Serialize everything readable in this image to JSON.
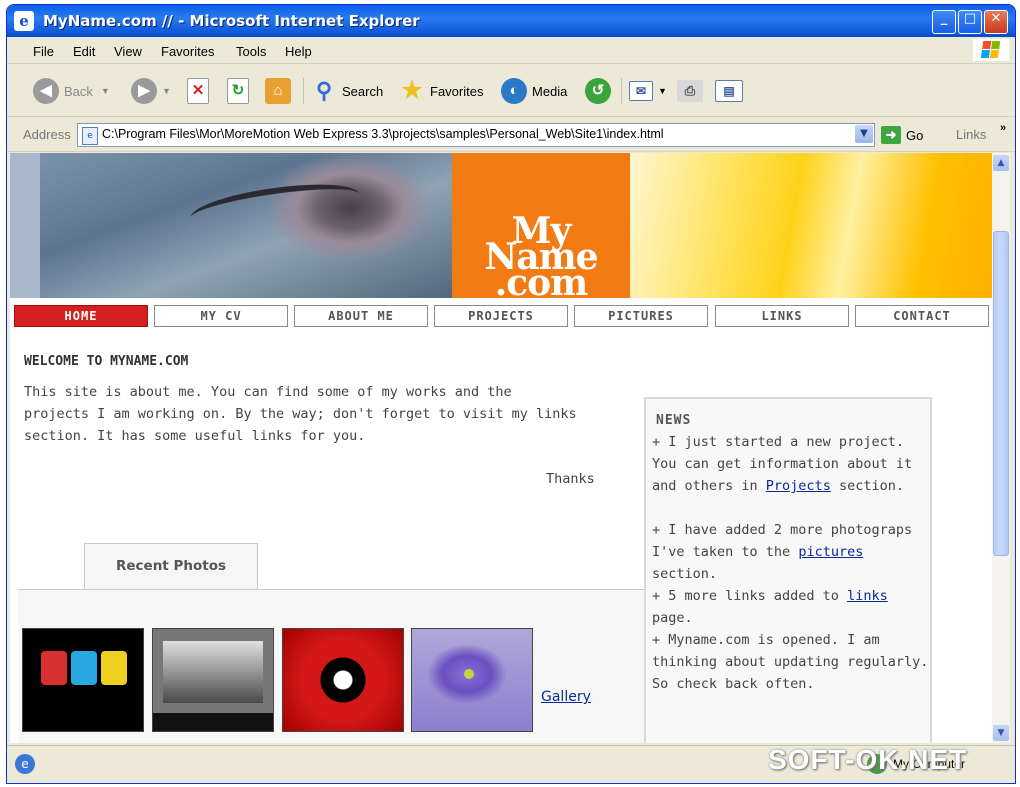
{
  "window": {
    "title": "MyName.com // - Microsoft Internet Explorer",
    "title_icon": "e",
    "minimize": "_",
    "maximize": "□",
    "close": "✕"
  },
  "menu": [
    "File",
    "Edit",
    "View",
    "Favorites",
    "Tools",
    "Help"
  ],
  "toolbar": {
    "back": "Back",
    "search": "Search",
    "favorites": "Favorites",
    "media": "Media"
  },
  "address": {
    "label": "Address",
    "url": "C:\\Program Files\\Mor\\MoreMotion Web Express 3.3\\projects\\samples\\Personal_Web\\Site1\\index.html",
    "go": "Go",
    "links": "Links",
    "links_chevron": "»"
  },
  "site": {
    "logo_line1": "My",
    "logo_line2": "Name",
    "logo_line3": ".com",
    "nav": [
      "HOME",
      "MY CV",
      "ABOUT ME",
      "PROJECTS",
      "PICTURES",
      "LINKS",
      "CONTACT"
    ],
    "active_nav": "HOME",
    "welcome_title": "WELCOME TO MYNAME.COM",
    "welcome_body": "This site is about me. You can find some of my works and the projects I am working on. By the way; don't forget to visit my links section. It has some useful links for you.",
    "thanks": "Thanks",
    "recent_tab": "Recent Photos",
    "gallery_link": "Gallery",
    "news": {
      "title": "NEWS",
      "item1_a": "+ I just started a new project. You can get information about it and others in ",
      "item1_link": "Projects",
      "item1_b": " section.",
      "item2_a": "+ I have added 2 more photograps I've taken to the ",
      "item2_link": "pictures",
      "item2_b": " section.",
      "item3_a": "+ 5 more links added to ",
      "item3_link": "links",
      "item3_b": " page.",
      "item4": "+ Myname.com is opened. I am thinking about updating regularly. So check back often."
    }
  },
  "status": {
    "zone": "My Computer"
  },
  "watermark": "SOFT-OK.NET"
}
